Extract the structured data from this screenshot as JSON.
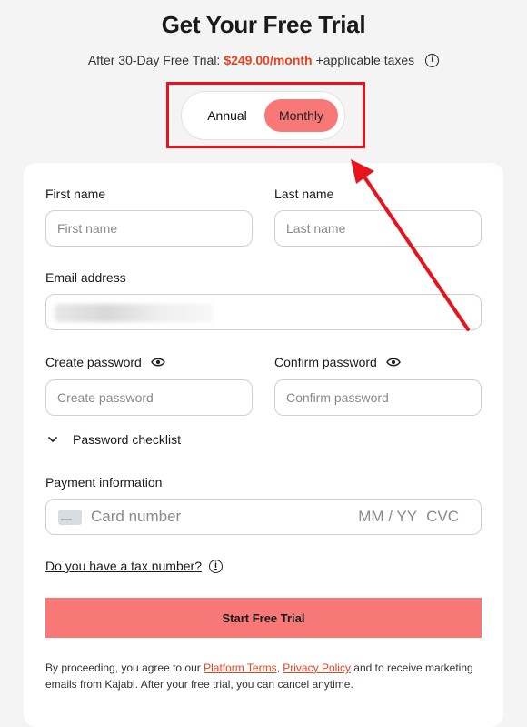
{
  "header": {
    "title": "Get Your Free Trial",
    "price_prefix": "After 30-Day Free Trial:",
    "price_amount": "$249.00/month",
    "price_suffix": "+applicable taxes"
  },
  "billing_toggle": {
    "annual_label": "Annual",
    "monthly_label": "Monthly",
    "selected": "Monthly"
  },
  "form": {
    "first_name_label": "First name",
    "first_name_placeholder": "First name",
    "last_name_label": "Last name",
    "last_name_placeholder": "Last name",
    "email_label": "Email address",
    "create_password_label": "Create password",
    "create_password_placeholder": "Create password",
    "confirm_password_label": "Confirm password",
    "confirm_password_placeholder": "Confirm password",
    "checklist_label": "Password checklist",
    "payment_label": "Payment information",
    "card_number_placeholder": "Card number",
    "expiry_placeholder": "MM / YY",
    "cvc_placeholder": "CVC",
    "tax_question": "Do you have a tax number?",
    "submit_label": "Start Free Trial"
  },
  "legal": {
    "prefix": "By proceeding, you agree to our ",
    "platform_terms": "Platform Terms",
    "separator": ", ",
    "privacy_policy": "Privacy Policy",
    "suffix": " and to receive marketing emails from Kajabi. After your free trial, you can cancel anytime."
  },
  "colors": {
    "accent": "#f87777",
    "price": "#e5431f",
    "annotation": "#e8141b",
    "background": "#f4f4f4"
  }
}
